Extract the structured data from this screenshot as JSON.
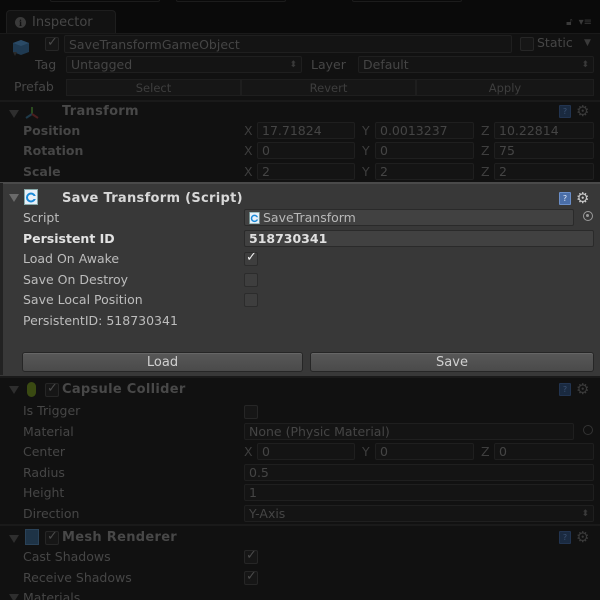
{
  "tab": {
    "title": "Inspector",
    "icon": "info-icon"
  },
  "tab_tools": {
    "lock": "lock-icon",
    "menu": "panel-menu-icon"
  },
  "object": {
    "active": true,
    "name": "SaveTransformGameObject",
    "static_label": "Static",
    "static": false,
    "tag_label": "Tag",
    "tag_value": "Untagged",
    "layer_label": "Layer",
    "layer_value": "Default",
    "prefab_label": "Prefab",
    "prefab_buttons": [
      "Select",
      "Revert",
      "Apply"
    ]
  },
  "transform": {
    "title": "Transform",
    "rows": [
      {
        "label": "Position",
        "x": "17.71824",
        "y": "0.0013237",
        "z": "10.22814"
      },
      {
        "label": "Rotation",
        "x": "0",
        "y": "0",
        "z": "75"
      },
      {
        "label": "Scale",
        "x": "2",
        "y": "2",
        "z": "2"
      }
    ],
    "axis_labels": [
      "X",
      "Y",
      "Z"
    ]
  },
  "save_transform": {
    "title": "Save Transform (Script)",
    "script_label": "Script",
    "script_value": "SaveTransform",
    "persistent_id_label": "Persistent ID",
    "persistent_id_value": "518730341",
    "load_on_awake_label": "Load On Awake",
    "load_on_awake": true,
    "save_on_destroy_label": "Save On Destroy",
    "save_on_destroy": false,
    "save_local_position_label": "Save Local Position",
    "save_local_position": false,
    "info_text": "PersistentID: 518730341",
    "load_button": "Load",
    "save_button": "Save"
  },
  "capsule_collider": {
    "title": "Capsule Collider",
    "enabled": true,
    "is_trigger_label": "Is Trigger",
    "is_trigger": false,
    "material_label": "Material",
    "material_value": "None (Physic Material)",
    "center_label": "Center",
    "center": {
      "x": "0",
      "y": "0",
      "z": "0"
    },
    "radius_label": "Radius",
    "radius_value": "0.5",
    "height_label": "Height",
    "height_value": "1",
    "direction_label": "Direction",
    "direction_value": "Y-Axis"
  },
  "mesh_renderer": {
    "title": "Mesh Renderer",
    "enabled": true,
    "cast_shadows_label": "Cast Shadows",
    "cast_shadows": true,
    "receive_shadows_label": "Receive Shadows",
    "receive_shadows": true,
    "materials_label": "Materials"
  }
}
